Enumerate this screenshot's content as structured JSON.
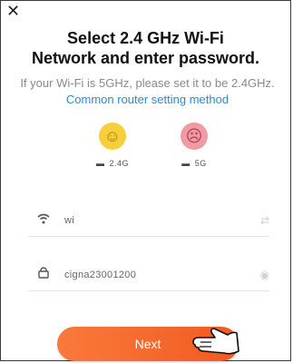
{
  "title": "Select 2.4 GHz Wi-Fi Network and enter password.",
  "title_line1": "Select 2.4 GHz Wi-Fi",
  "title_line2": "Network and enter password.",
  "subtitle_text": "If your Wi-Fi is 5GHz, please set it to be 2.4GHz.",
  "subtitle_link": "Common router setting method",
  "options": [
    {
      "band_label": "2.4G",
      "status": "supported",
      "icon": "happy-face-icon",
      "color": "#f7cf3c"
    },
    {
      "band_label": "5G",
      "status": "unsupported",
      "icon": "sad-face-icon",
      "color": "#f09aa3"
    }
  ],
  "ssid_field": {
    "value": "wi",
    "icon": "wifi-icon",
    "trail_icon": "switch-arrows-icon"
  },
  "password_field": {
    "value": "cigna23001200",
    "icon": "lock-icon",
    "trail_icon": "eye-icon"
  },
  "next_button": {
    "label": "Next",
    "color": "#f15a1f"
  }
}
